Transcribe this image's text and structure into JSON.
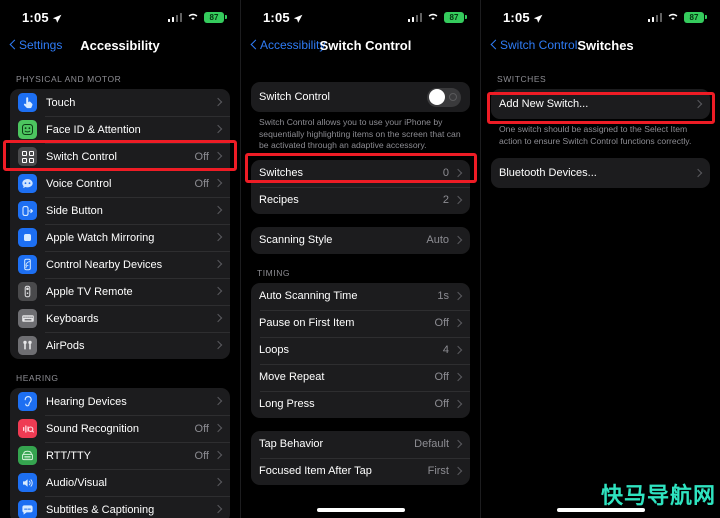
{
  "status_bar": {
    "time": "1:05",
    "battery": "87",
    "location_icon": "location-arrow-icon",
    "wifi_icon": "wifi-icon",
    "cellular_icon": "cellular-bars-icon"
  },
  "colors": {
    "accent_blue": "#2f7cf6",
    "highlight_red": "#ee1c25",
    "group_bg": "#1c1c1e",
    "secondary_text": "#8d8d93",
    "battery_green": "#35cb5d"
  },
  "watermark": {
    "text": "快马导航网"
  },
  "screen1": {
    "back_label": "Settings",
    "title": "Accessibility",
    "sections": [
      {
        "header": "PHYSICAL AND MOTOR",
        "items": [
          {
            "label": "Touch",
            "value": "",
            "icon": "touch-pointer-icon",
            "icon_bg": "#1d6ff2"
          },
          {
            "label": "Face ID & Attention",
            "value": "",
            "icon": "face-id-icon",
            "icon_bg": "#30d158"
          },
          {
            "label": "Switch Control",
            "value": "Off",
            "icon": "switch-control-grid-icon",
            "icon_bg": "#4a4a4c",
            "highlighted": true
          },
          {
            "label": "Voice Control",
            "value": "Off",
            "icon": "voice-control-icon",
            "icon_bg": "#1d6ff2"
          },
          {
            "label": "Side Button",
            "value": "",
            "icon": "side-button-icon",
            "icon_bg": "#1d6ff2"
          },
          {
            "label": "Apple Watch Mirroring",
            "value": "",
            "icon": "apple-watch-mirroring-icon",
            "icon_bg": "#1d6ff2"
          },
          {
            "label": "Control Nearby Devices",
            "value": "",
            "icon": "control-nearby-devices-icon",
            "icon_bg": "#1d6ff2"
          },
          {
            "label": "Apple TV Remote",
            "value": "",
            "icon": "apple-tv-remote-icon",
            "icon_bg": "#4a4a4c"
          },
          {
            "label": "Keyboards",
            "value": "",
            "icon": "keyboard-icon",
            "icon_bg": "#6e6e72"
          },
          {
            "label": "AirPods",
            "value": "",
            "icon": "airpods-icon",
            "icon_bg": "#6e6e72"
          }
        ]
      },
      {
        "header": "HEARING",
        "items": [
          {
            "label": "Hearing Devices",
            "value": "",
            "icon": "hearing-devices-icon",
            "icon_bg": "#1d6ff2"
          },
          {
            "label": "Sound Recognition",
            "value": "Off",
            "icon": "sound-recognition-icon",
            "icon_bg": "#ef3b53"
          },
          {
            "label": "RTT/TTY",
            "value": "Off",
            "icon": "rtt-tty-icon",
            "icon_bg": "#30a14e"
          },
          {
            "label": "Audio/Visual",
            "value": "",
            "icon": "audio-visual-icon",
            "icon_bg": "#1d6ff2"
          },
          {
            "label": "Subtitles & Captioning",
            "value": "",
            "icon": "subtitles-captioning-icon",
            "icon_bg": "#1d6ff2"
          }
        ]
      }
    ]
  },
  "screen2": {
    "back_label": "Accessibility",
    "title": "Switch Control",
    "toggle_row": {
      "label": "Switch Control",
      "state": "off"
    },
    "description": "Switch Control allows you to use your iPhone by sequentially highlighting items on the screen that can be activated through an adaptive accessory.",
    "group_switches": [
      {
        "label": "Switches",
        "value": "0",
        "highlighted": true
      },
      {
        "label": "Recipes",
        "value": "2"
      }
    ],
    "group_scanning": [
      {
        "label": "Scanning Style",
        "value": "Auto"
      }
    ],
    "timing_header": "TIMING",
    "group_timing": [
      {
        "label": "Auto Scanning Time",
        "value": "1s"
      },
      {
        "label": "Pause on First Item",
        "value": "Off"
      },
      {
        "label": "Loops",
        "value": "4"
      },
      {
        "label": "Move Repeat",
        "value": "Off"
      },
      {
        "label": "Long Press",
        "value": "Off"
      }
    ],
    "group_tap": [
      {
        "label": "Tap Behavior",
        "value": "Default"
      },
      {
        "label": "Focused Item After Tap",
        "value": "First"
      }
    ]
  },
  "screen3": {
    "back_label": "Switch Control",
    "title": "Switches",
    "section_header": "SWITCHES",
    "group_add": [
      {
        "label": "Add New Switch...",
        "value": "",
        "highlighted": true
      }
    ],
    "footnote": "One switch should be assigned to the Select Item action to ensure Switch Control functions correctly.",
    "group_bluetooth": [
      {
        "label": "Bluetooth Devices...",
        "value": ""
      }
    ]
  }
}
